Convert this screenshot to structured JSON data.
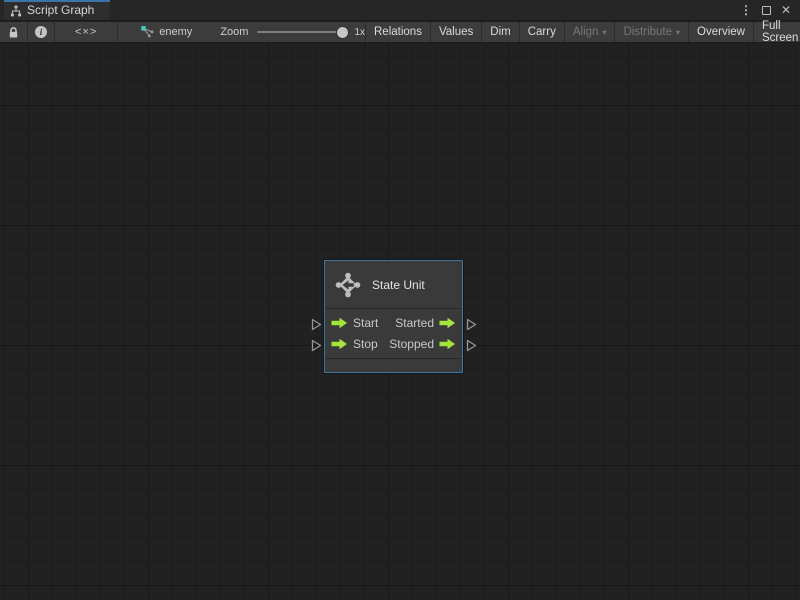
{
  "tab": {
    "label": "Script Graph"
  },
  "window_controls": {
    "menu_glyph": "⋮",
    "close_glyph": "✕"
  },
  "toolbar": {
    "code_glyph": "<×>",
    "graph_name": "enemy",
    "zoom_label": "Zoom",
    "zoom_value": "1x",
    "dropdown_glyph": "▾",
    "buttons": [
      {
        "label": "Relations",
        "enabled": true
      },
      {
        "label": "Values",
        "enabled": true
      },
      {
        "label": "Dim",
        "enabled": true
      },
      {
        "label": "Carry",
        "enabled": true
      },
      {
        "label": "Align",
        "enabled": false,
        "dropdown": true
      },
      {
        "label": "Distribute",
        "enabled": false,
        "dropdown": true
      },
      {
        "label": "Overview",
        "enabled": true
      },
      {
        "label": "Full Screen",
        "enabled": true
      }
    ]
  },
  "node": {
    "title": "State Unit",
    "rows": [
      {
        "input": "Start",
        "output": "Started"
      },
      {
        "input": "Stop",
        "output": "Stopped"
      }
    ]
  },
  "colors": {
    "tab_accent_blue": "#3b74a8",
    "node_border_blue": "#41749c",
    "port_arrow_green": "#a3e53c",
    "canvas_background": "#212121",
    "toolbar_background": "#3c3c3c",
    "node_background": "#3a3a3a"
  }
}
